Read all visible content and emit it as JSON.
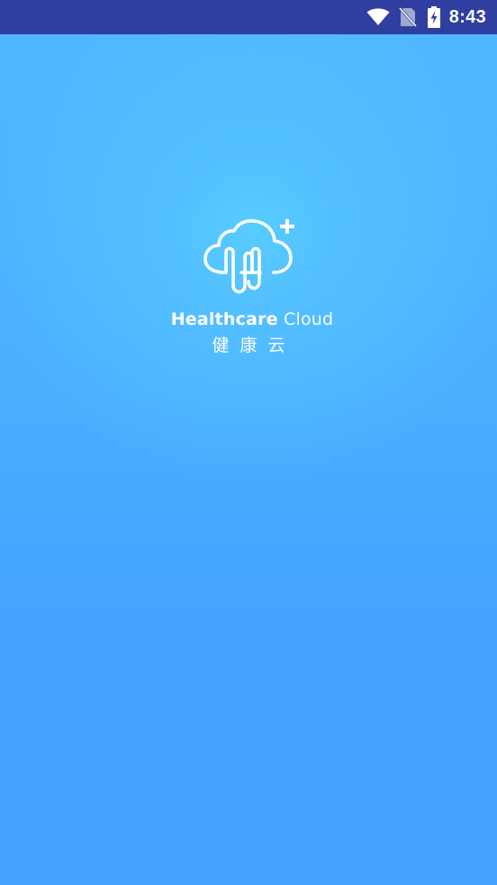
{
  "status_bar": {
    "time": "8:43",
    "background": "#303f9f",
    "icons": [
      "wifi-icon",
      "no-sim-icon",
      "battery-charging-icon"
    ]
  },
  "splash": {
    "logo_icon": "cloud-health-plus-icon",
    "brand_bold": "Healthcare",
    "brand_light": " Cloud",
    "brand_cn": "健康云",
    "gradient_colors": [
      "#57ccff",
      "#44a3ff"
    ]
  }
}
